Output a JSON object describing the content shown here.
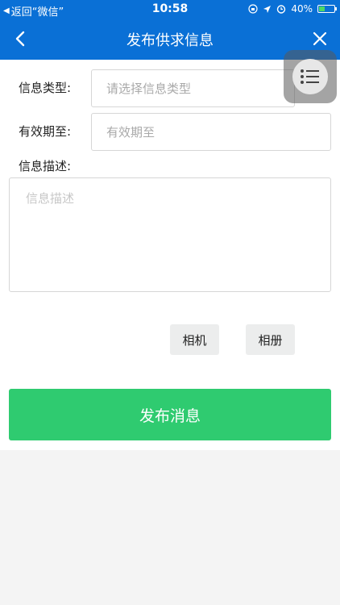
{
  "status_bar": {
    "back_app": "返回“微信”",
    "time": "10:58",
    "battery": "40%",
    "battery_level": 0.4,
    "icons": [
      "lock-rotation-icon",
      "location-arrow-icon",
      "alarm-icon",
      "battery-icon"
    ]
  },
  "nav": {
    "title": "发布供求信息",
    "back_icon": "chevron-left-icon",
    "close_icon": "close-icon"
  },
  "form": {
    "type_label": "信息类型:",
    "type_placeholder": "请选择信息类型",
    "expiry_label": "有效期至:",
    "expiry_placeholder": "有效期至",
    "desc_label": "信息描述:",
    "desc_placeholder": "信息描述"
  },
  "upload": {
    "camera": "相机",
    "album": "相册"
  },
  "submit_label": "发布消息",
  "colors": {
    "nav_blue": "#0a70d6",
    "submit_green": "#2fcb70"
  }
}
